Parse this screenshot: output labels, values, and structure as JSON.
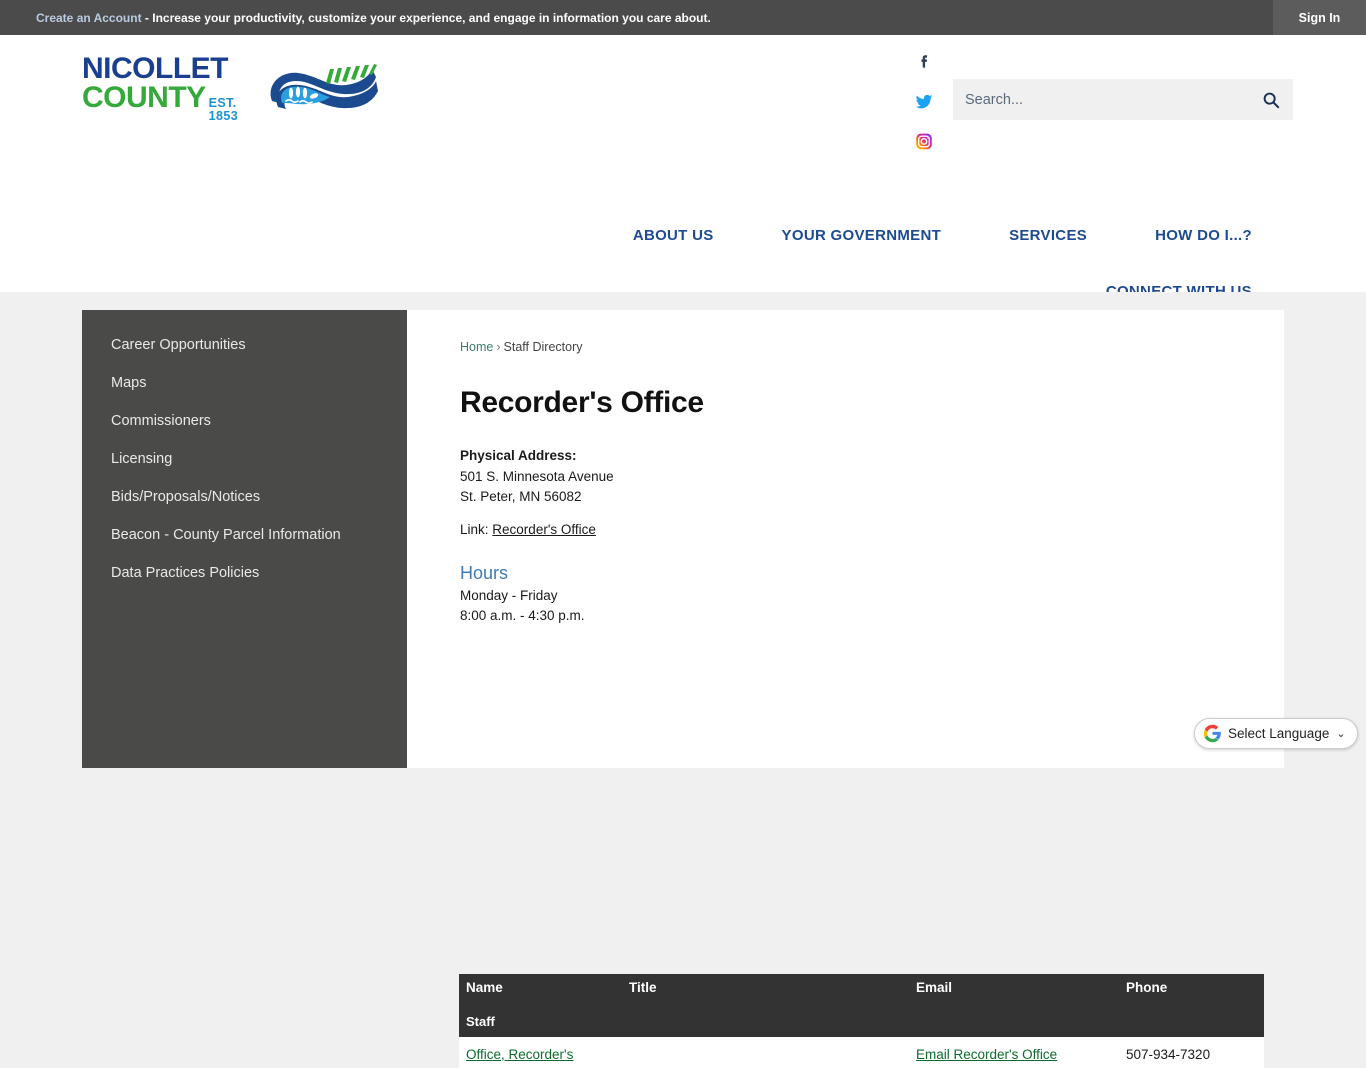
{
  "topbar": {
    "account_link": "Create an Account",
    "message": " - Increase your productivity, customize your experience, and engage in information you care about.",
    "signin_label": "Sign In"
  },
  "header": {
    "logo": {
      "line1": "NICOLLET",
      "county": "COUNTY",
      "established": "EST. 1853",
      "mark_name": "nicollet-county-river-emblem"
    },
    "social": [
      {
        "name": "facebook-icon",
        "label": "Facebook",
        "color": "#2e3d5c"
      },
      {
        "name": "twitter-icon",
        "label": "Twitter",
        "color": "#1da1f2"
      },
      {
        "name": "instagram-icon",
        "label": "Instagram",
        "color": "#d6249f"
      }
    ],
    "search": {
      "placeholder": "Search...",
      "value": "",
      "button_icon": "search-icon"
    },
    "nav_primary": [
      {
        "label": "ABOUT US"
      },
      {
        "label": "YOUR GOVERNMENT"
      },
      {
        "label": "SERVICES"
      },
      {
        "label": "HOW DO I...?"
      }
    ],
    "nav_secondary": [
      {
        "label": "CONNECT WITH US"
      }
    ]
  },
  "sidebar": {
    "items": [
      {
        "label": "Career Opportunities"
      },
      {
        "label": "Maps"
      },
      {
        "label": "Commissioners"
      },
      {
        "label": "Licensing"
      },
      {
        "label": "Bids/Proposals/Notices"
      },
      {
        "label": "Beacon - County Parcel Information"
      },
      {
        "label": "Data Practices Policies"
      }
    ]
  },
  "main": {
    "breadcrumb": {
      "home": "Home",
      "separator": "›",
      "current": "Staff Directory"
    },
    "title": "Recorder's Office",
    "address": {
      "label": "Physical Address:",
      "line1": "501 S. Minnesota Avenue",
      "line2": "St. Peter, MN 56082"
    },
    "link": {
      "prefix": "Link:",
      "text": "Recorder's Office"
    },
    "hours": {
      "heading": "Hours",
      "days": "Monday - Friday",
      "times": "8:00 a.m. - 4:30 p.m."
    },
    "staff_table": {
      "caption": "Staff",
      "columns": [
        "Name",
        "Title",
        "Email",
        "Phone"
      ],
      "rows": [
        {
          "name": "Office, Recorder's",
          "title": "",
          "email": "Email Recorder's Office",
          "phone": "507-934-7320"
        }
      ]
    }
  },
  "translate_widget": {
    "icon": "google-g-icon",
    "label": "Select Language",
    "chevron": "chevron-down-icon",
    "chevron_glyph": "⌄"
  },
  "colors": {
    "topbar_bg": "#4b4b4b",
    "nav_blue": "#1e4b8f",
    "logo_navy": "#1b3f8f",
    "logo_green": "#35a93a",
    "logo_est_blue": "#1b93d1",
    "sidebar_bg": "#4a4a48",
    "table_header_bg": "#333333",
    "link_green": "#0d6b2e",
    "hours_blue": "#3d7cb5",
    "page_bg": "#f0f0f0"
  }
}
